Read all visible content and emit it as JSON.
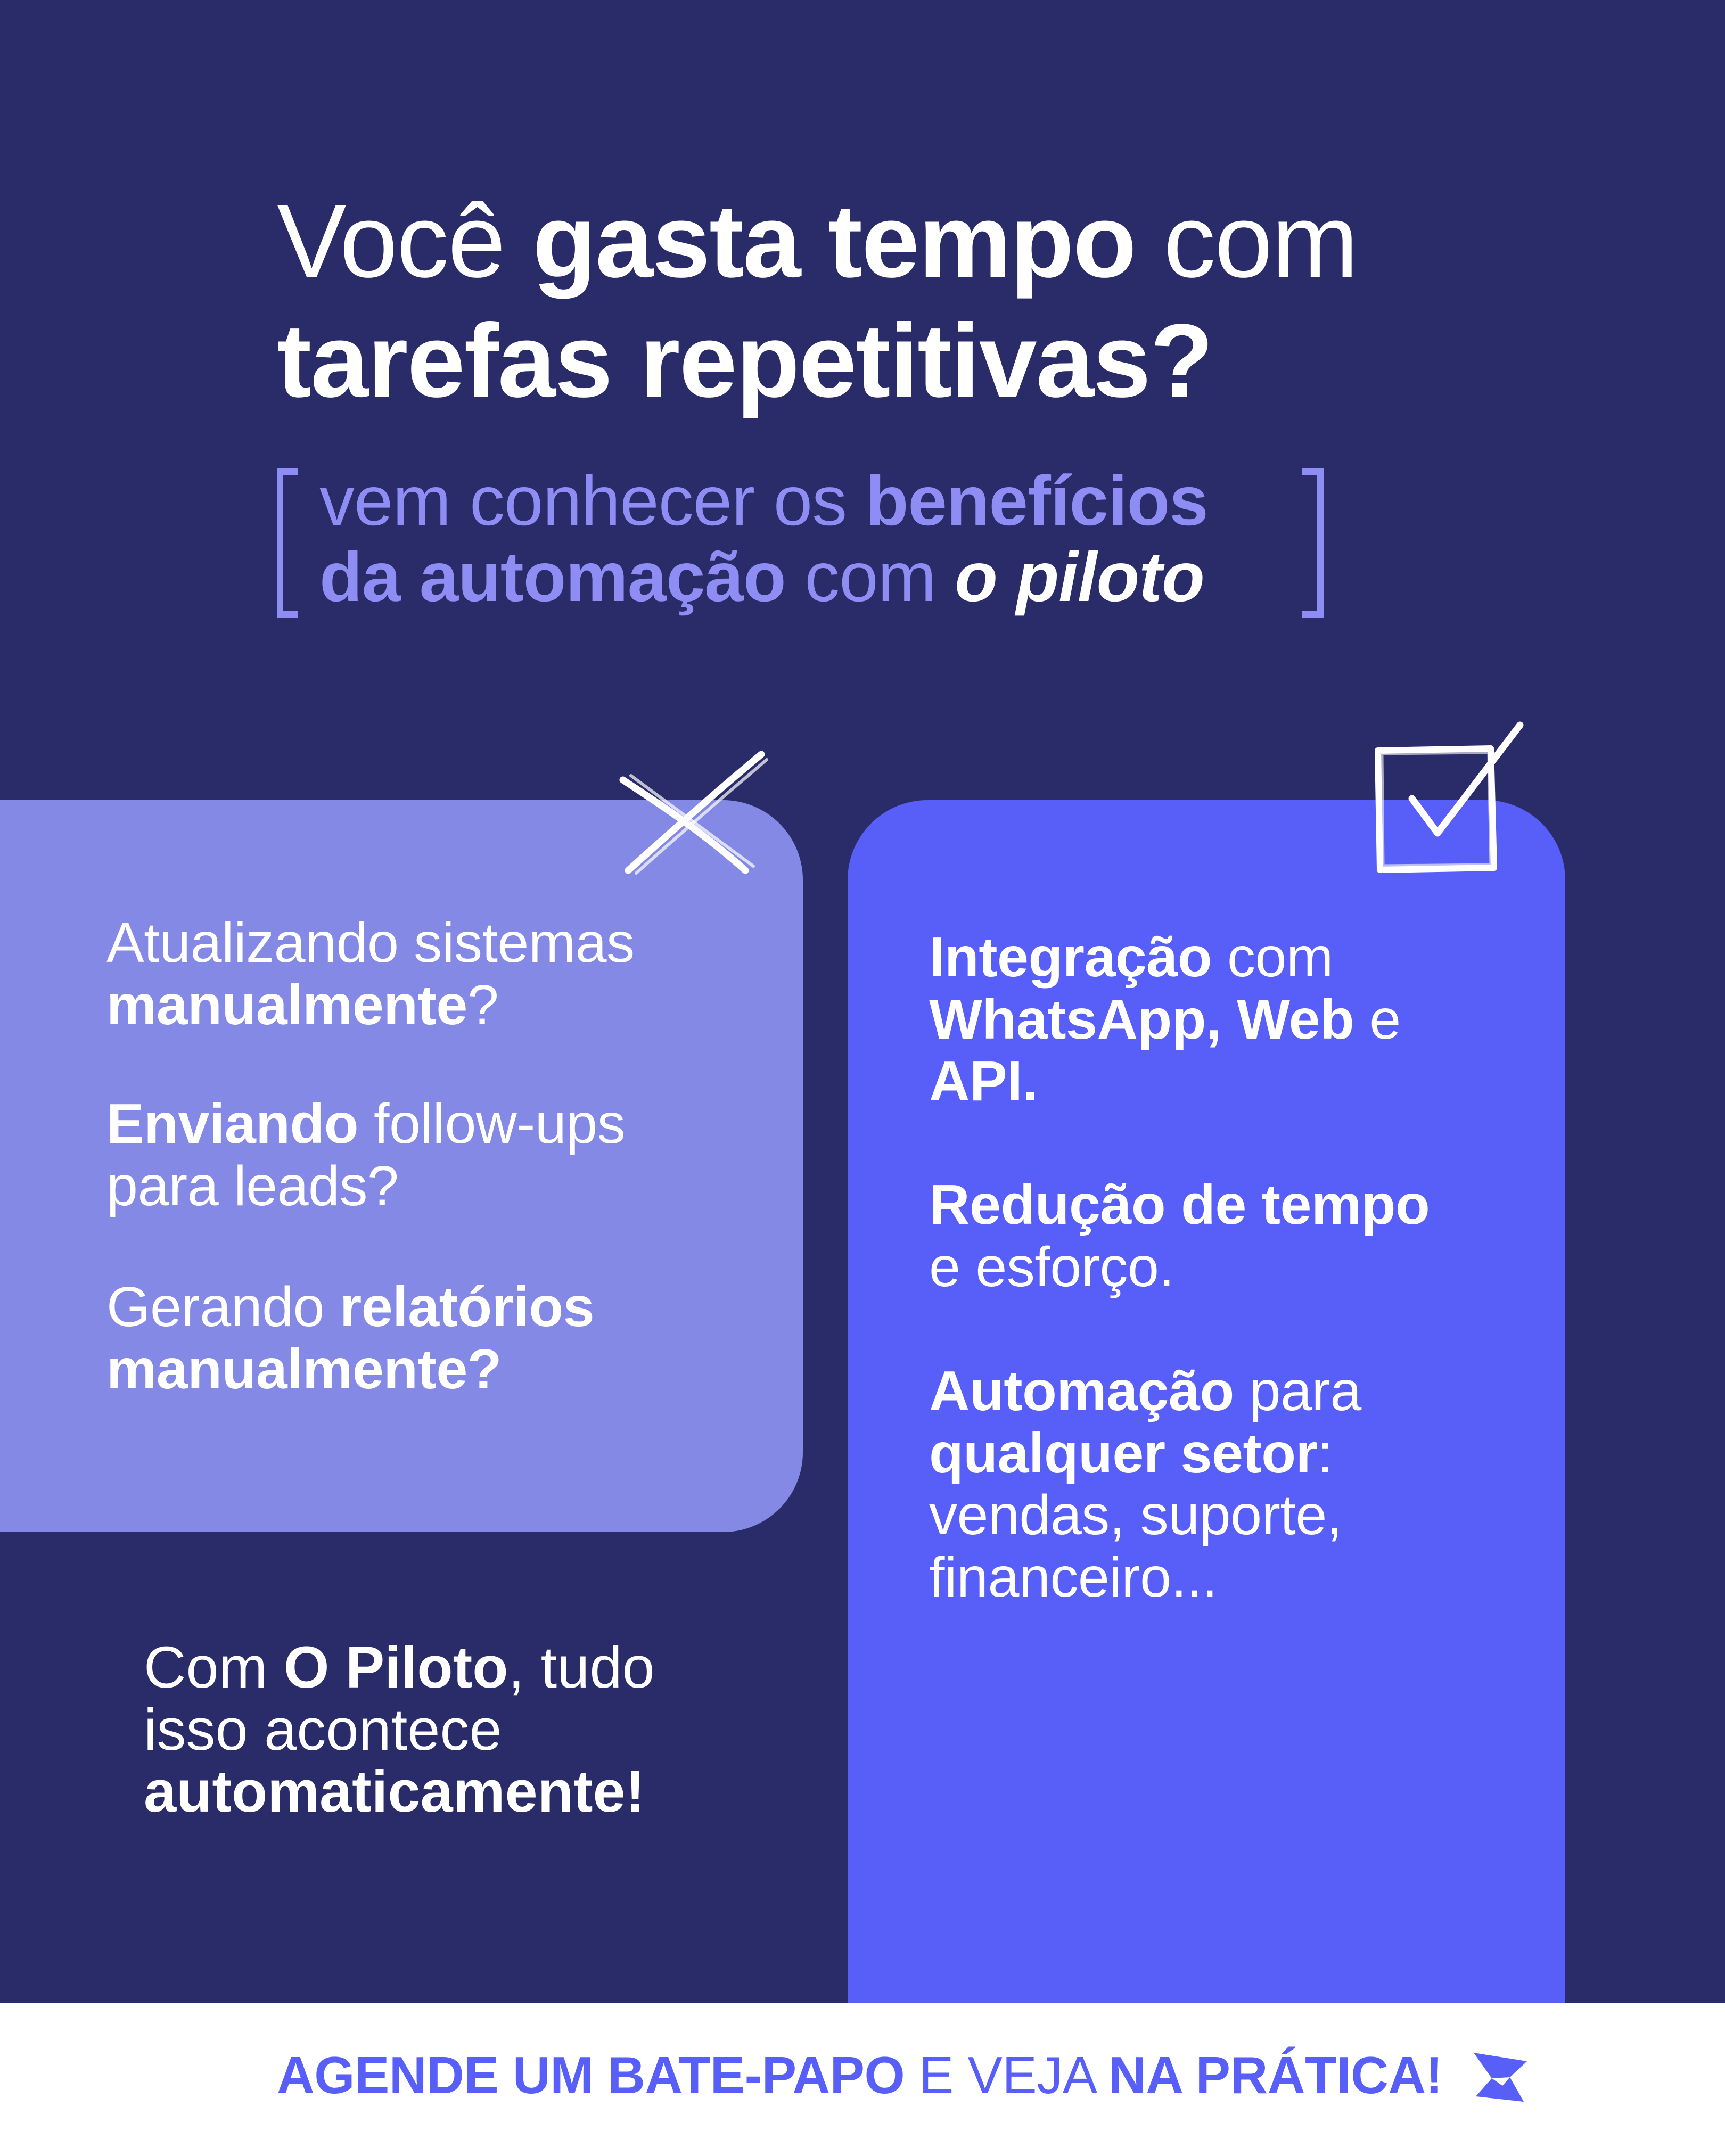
{
  "headline": {
    "line1_a": "Você ",
    "line1_b": "gasta tempo",
    "line1_c": " com",
    "line2": "tarefas repetitivas?"
  },
  "subtitle": {
    "a": "vem conhecer os ",
    "b": "benefícios",
    "c": "da automação",
    "d": " com ",
    "e": "o piloto"
  },
  "problems": {
    "item1_a": "Atualizando sistemas",
    "item1_b": "manualmente",
    "item1_c": "?",
    "item2_a": "Enviando",
    "item2_b": " follow-ups",
    "item2_c": "para leads?",
    "item3_a": "Gerando ",
    "item3_b": "relatórios",
    "item3_c": "manualmente?"
  },
  "benefits": {
    "item1_a": "Integração",
    "item1_b": " com",
    "item1_c": "WhatsApp, Web",
    "item1_d": " e",
    "item1_e": "API.",
    "item2_a": "Redução de tempo",
    "item2_b": "e esforço.",
    "item3_a": "Automação",
    "item3_b": " para",
    "item3_c": "qualquer setor",
    "item3_d": ":",
    "item3_e": "vendas, suporte,",
    "item3_f": "financeiro..."
  },
  "closing": {
    "a": "Com ",
    "b": "O Piloto",
    "c": ", tudo",
    "d": "isso acontece",
    "e": "automaticamente!"
  },
  "cta": {
    "a": "AGENDE UM BATE-PAPO",
    "b": " E VEJA ",
    "c": "NA PRÁTICA!"
  },
  "icons": {
    "problem_mark": "x-icon",
    "benefit_mark": "checkbox-icon",
    "brand": "logo-icon"
  },
  "colors": {
    "background": "#2A2C69",
    "problem_card": "#8489E6",
    "benefit_card": "#585EF8",
    "accent_text": "#8D8DF3",
    "footer": "#FFFFFF"
  }
}
